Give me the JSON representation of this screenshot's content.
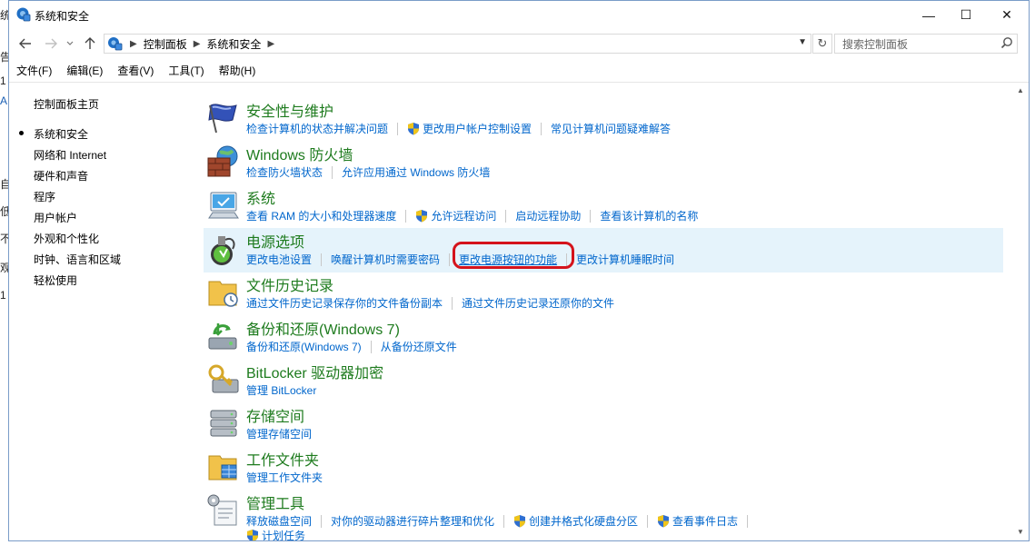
{
  "window": {
    "title": "系统和安全",
    "controls": {
      "minimize": "—",
      "maximize": "☐",
      "close": "✕"
    }
  },
  "background_chars": [
    "统",
    "告",
    "1",
    "A",
    "自",
    "低",
    "不",
    "观",
    "1"
  ],
  "nav": {
    "breadcrumb": [
      "控制面板",
      "系统和安全"
    ],
    "search_placeholder": "搜索控制面板"
  },
  "menu": [
    "文件(F)",
    "编辑(E)",
    "查看(V)",
    "工具(T)",
    "帮助(H)"
  ],
  "sidebar": {
    "items": [
      "控制面板主页",
      "系统和安全",
      "网络和 Internet",
      "硬件和声音",
      "程序",
      "用户帐户",
      "外观和个性化",
      "时钟、语言和区域",
      "轻松使用"
    ],
    "current": "系统和安全"
  },
  "categories": [
    {
      "title": "安全性与维护",
      "links": [
        "检查计算机的状态并解决问题",
        "更改用户帐户控制设置",
        "常见计算机问题疑难解答"
      ]
    },
    {
      "title": "Windows 防火墙",
      "links": [
        "检查防火墙状态",
        "允许应用通过 Windows 防火墙"
      ]
    },
    {
      "title": "系统",
      "links": [
        "查看 RAM 的大小和处理器速度",
        "允许远程访问",
        "启动远程协助",
        "查看该计算机的名称"
      ]
    },
    {
      "title": "电源选项",
      "links": [
        "更改电池设置",
        "唤醒计算机时需要密码",
        "更改电源按钮的功能",
        "更改计算机睡眠时间"
      ]
    },
    {
      "title": "文件历史记录",
      "links": [
        "通过文件历史记录保存你的文件备份副本",
        "通过文件历史记录还原你的文件"
      ]
    },
    {
      "title": "备份和还原(Windows 7)",
      "links": [
        "备份和还原(Windows 7)",
        "从备份还原文件"
      ]
    },
    {
      "title": "BitLocker 驱动器加密",
      "links": [
        "管理 BitLocker"
      ]
    },
    {
      "title": "存储空间",
      "links": [
        "管理存储空间"
      ]
    },
    {
      "title": "工作文件夹",
      "links": [
        "管理工作文件夹"
      ]
    },
    {
      "title": "管理工具",
      "links": [
        "释放磁盘空间",
        "对你的驱动器进行碎片整理和优化",
        "创建并格式化硬盘分区",
        "查看事件日志",
        "计划任务"
      ]
    }
  ],
  "colors": {
    "category_title": "#1e7b1e",
    "link": "#0066cc",
    "highlight": "#e5f3fb",
    "annotation": "#d4131b"
  }
}
